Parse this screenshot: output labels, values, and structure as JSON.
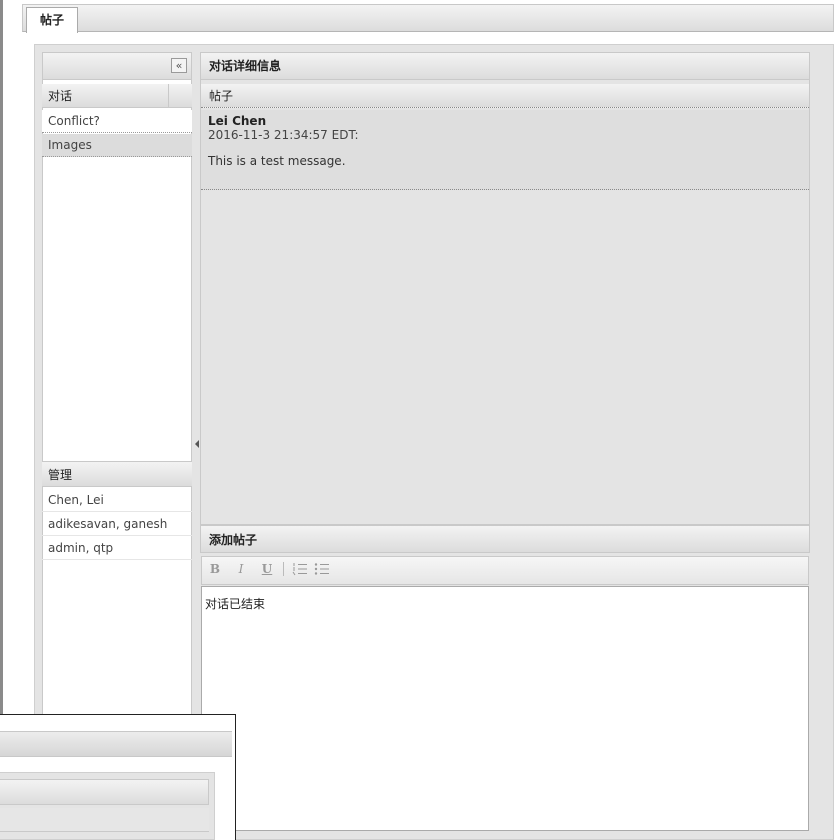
{
  "tab": {
    "label": "帖子"
  },
  "left": {
    "collapse_label": "«",
    "conversations_header": "对话",
    "conversations": [
      {
        "label": "Conflict?",
        "icon": "lock-icon"
      },
      {
        "label": "Images",
        "icon": "lock-icon"
      }
    ],
    "admin_header": "管理",
    "admins": [
      "Chen, Lei",
      "adikesavan, ganesh",
      "admin, qtp"
    ]
  },
  "details": {
    "header": "对话详细信息",
    "subheader": "帖子",
    "post": {
      "author": "Lei Chen",
      "timestamp": "2016-11-3 21:34:57 EDT:",
      "message": "This is a test message."
    }
  },
  "add_post": {
    "header": "添加帖子",
    "toolbar": {
      "bold": "B",
      "italic": "I",
      "underline": "U"
    },
    "content": "对话已结束"
  }
}
